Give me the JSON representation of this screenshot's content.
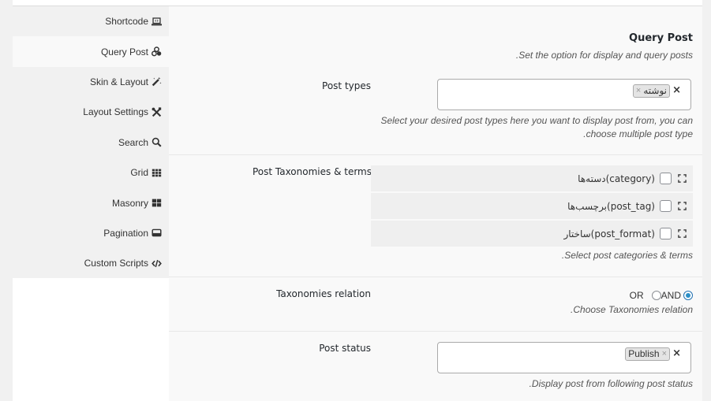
{
  "sidebar": {
    "items": [
      {
        "label": "Shortcode",
        "icon": "laptop-code-icon",
        "active": false
      },
      {
        "label": "Query Post",
        "icon": "cubes-icon",
        "active": true
      },
      {
        "label": "Skin & Layout",
        "icon": "magic-wand-icon",
        "active": false
      },
      {
        "label": "Layout Settings",
        "icon": "tools-icon",
        "active": false
      },
      {
        "label": "Search",
        "icon": "search-icon",
        "active": false
      },
      {
        "label": "Grid",
        "icon": "grid-icon",
        "active": false
      },
      {
        "label": "Masonry",
        "icon": "masonry-icon",
        "active": false
      },
      {
        "label": "Pagination",
        "icon": "pagination-icon",
        "active": false
      },
      {
        "label": "Custom Scripts",
        "icon": "code-icon",
        "active": false
      }
    ]
  },
  "section": {
    "title": "Query Post",
    "subtitle": ".Set the option for display and query posts"
  },
  "fields": {
    "post_types": {
      "label": "Post types",
      "selected": [
        "نوشته"
      ],
      "help_line1": "Select your desired post types here you want to display post from, you can",
      "help_line2": ".choose multiple post type"
    },
    "taxonomies": {
      "label": "Post Taxonomies & terms",
      "items": [
        {
          "label": "دسته‌ها(category)",
          "checked": false
        },
        {
          "label": "برچسب‌ها(post_tag)",
          "checked": false
        },
        {
          "label": "ساختار(post_format)",
          "checked": false
        }
      ],
      "help": ".Select post categories & terms"
    },
    "relation": {
      "label": "Taxonomies relation",
      "options": [
        {
          "label": "AND",
          "checked": true
        },
        {
          "label": "OR",
          "checked": false
        }
      ],
      "help": ".Choose Taxonomies relation"
    },
    "post_status": {
      "label": "Post status",
      "selected": [
        "Publish"
      ],
      "help": ".Display post from following post status"
    }
  },
  "colors": {
    "accent": "#2a8fc7",
    "panel_bg": "#f9f9f9",
    "sidebar_bg": "#f1f1f1"
  }
}
